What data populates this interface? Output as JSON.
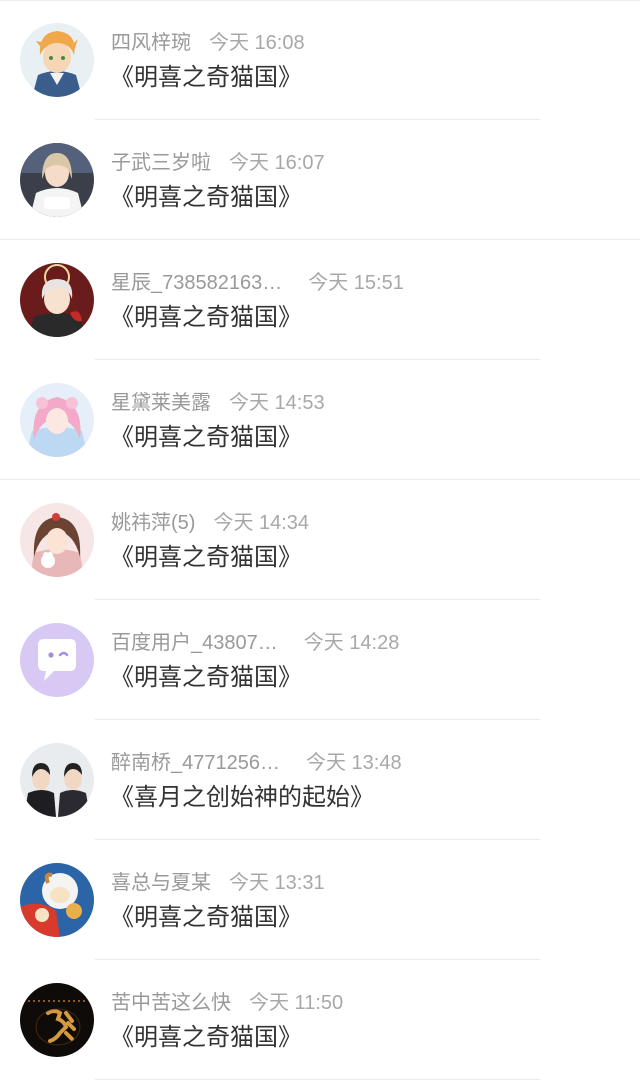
{
  "messages": [
    {
      "name": "四风梓琬",
      "time": "今天 16:08",
      "title": "《明喜之奇猫国》",
      "avatar_icon": "anime-boy-avatar"
    },
    {
      "name": "子武三岁啦",
      "time": "今天 16:07",
      "title": "《明喜之奇猫国》",
      "avatar_icon": "girl-photo-avatar"
    },
    {
      "name": "星辰_738582163…",
      "time": "今天 15:51",
      "title": "《明喜之奇猫国》",
      "avatar_icon": "anime-angel-avatar"
    },
    {
      "name": "星黛莱美露",
      "time": "今天 14:53",
      "title": "《明喜之奇猫国》",
      "avatar_icon": "pink-anime-girl-avatar"
    },
    {
      "name": "姚祎萍(5)",
      "time": "今天 14:34",
      "title": "《明喜之奇猫国》",
      "avatar_icon": "doll-avatar"
    },
    {
      "name": "百度用户_43807…",
      "time": "今天 14:28",
      "title": "《明喜之奇猫国》",
      "avatar_icon": "default-chat-bubble-avatar"
    },
    {
      "name": "醉南桥_4771256…",
      "time": "今天 13:48",
      "title": "《喜月之创始神的起始》",
      "avatar_icon": "two-men-photo-avatar"
    },
    {
      "name": "喜总与夏某",
      "time": "今天 13:31",
      "title": "《明喜之奇猫国》",
      "avatar_icon": "cartoon-sheep-avatar"
    },
    {
      "name": "苦中苦这么快",
      "time": "今天 11:50",
      "title": "《明喜之奇猫国》",
      "avatar_icon": "calligraphy-avatar"
    }
  ]
}
